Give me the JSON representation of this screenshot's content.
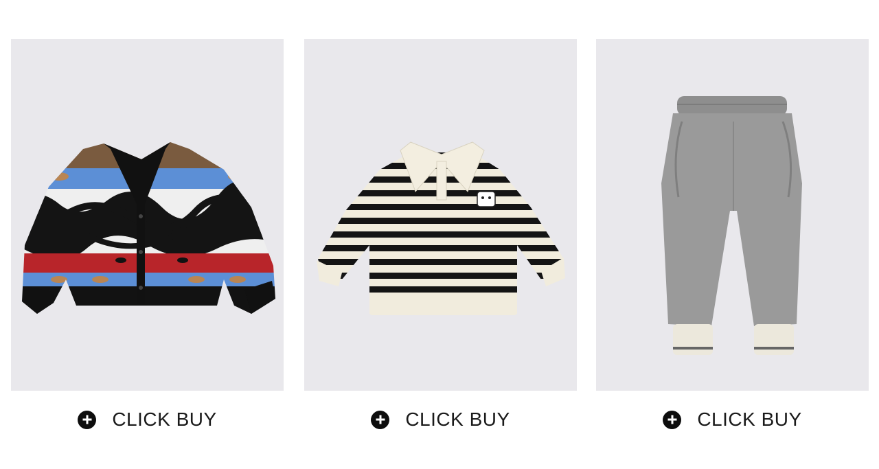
{
  "products": [
    {
      "name": "cardigan",
      "cta_label": "CLICK BUY",
      "cta_icon": "plus-circle-icon",
      "background": "#e9e8ec"
    },
    {
      "name": "striped-polo-sweatshirt",
      "cta_label": "CLICK BUY",
      "cta_icon": "plus-circle-icon",
      "background": "#e9e8ec"
    },
    {
      "name": "jogger-pants",
      "cta_label": "CLICK BUY",
      "cta_icon": "plus-circle-icon",
      "background": "#e9e8ec"
    }
  ]
}
